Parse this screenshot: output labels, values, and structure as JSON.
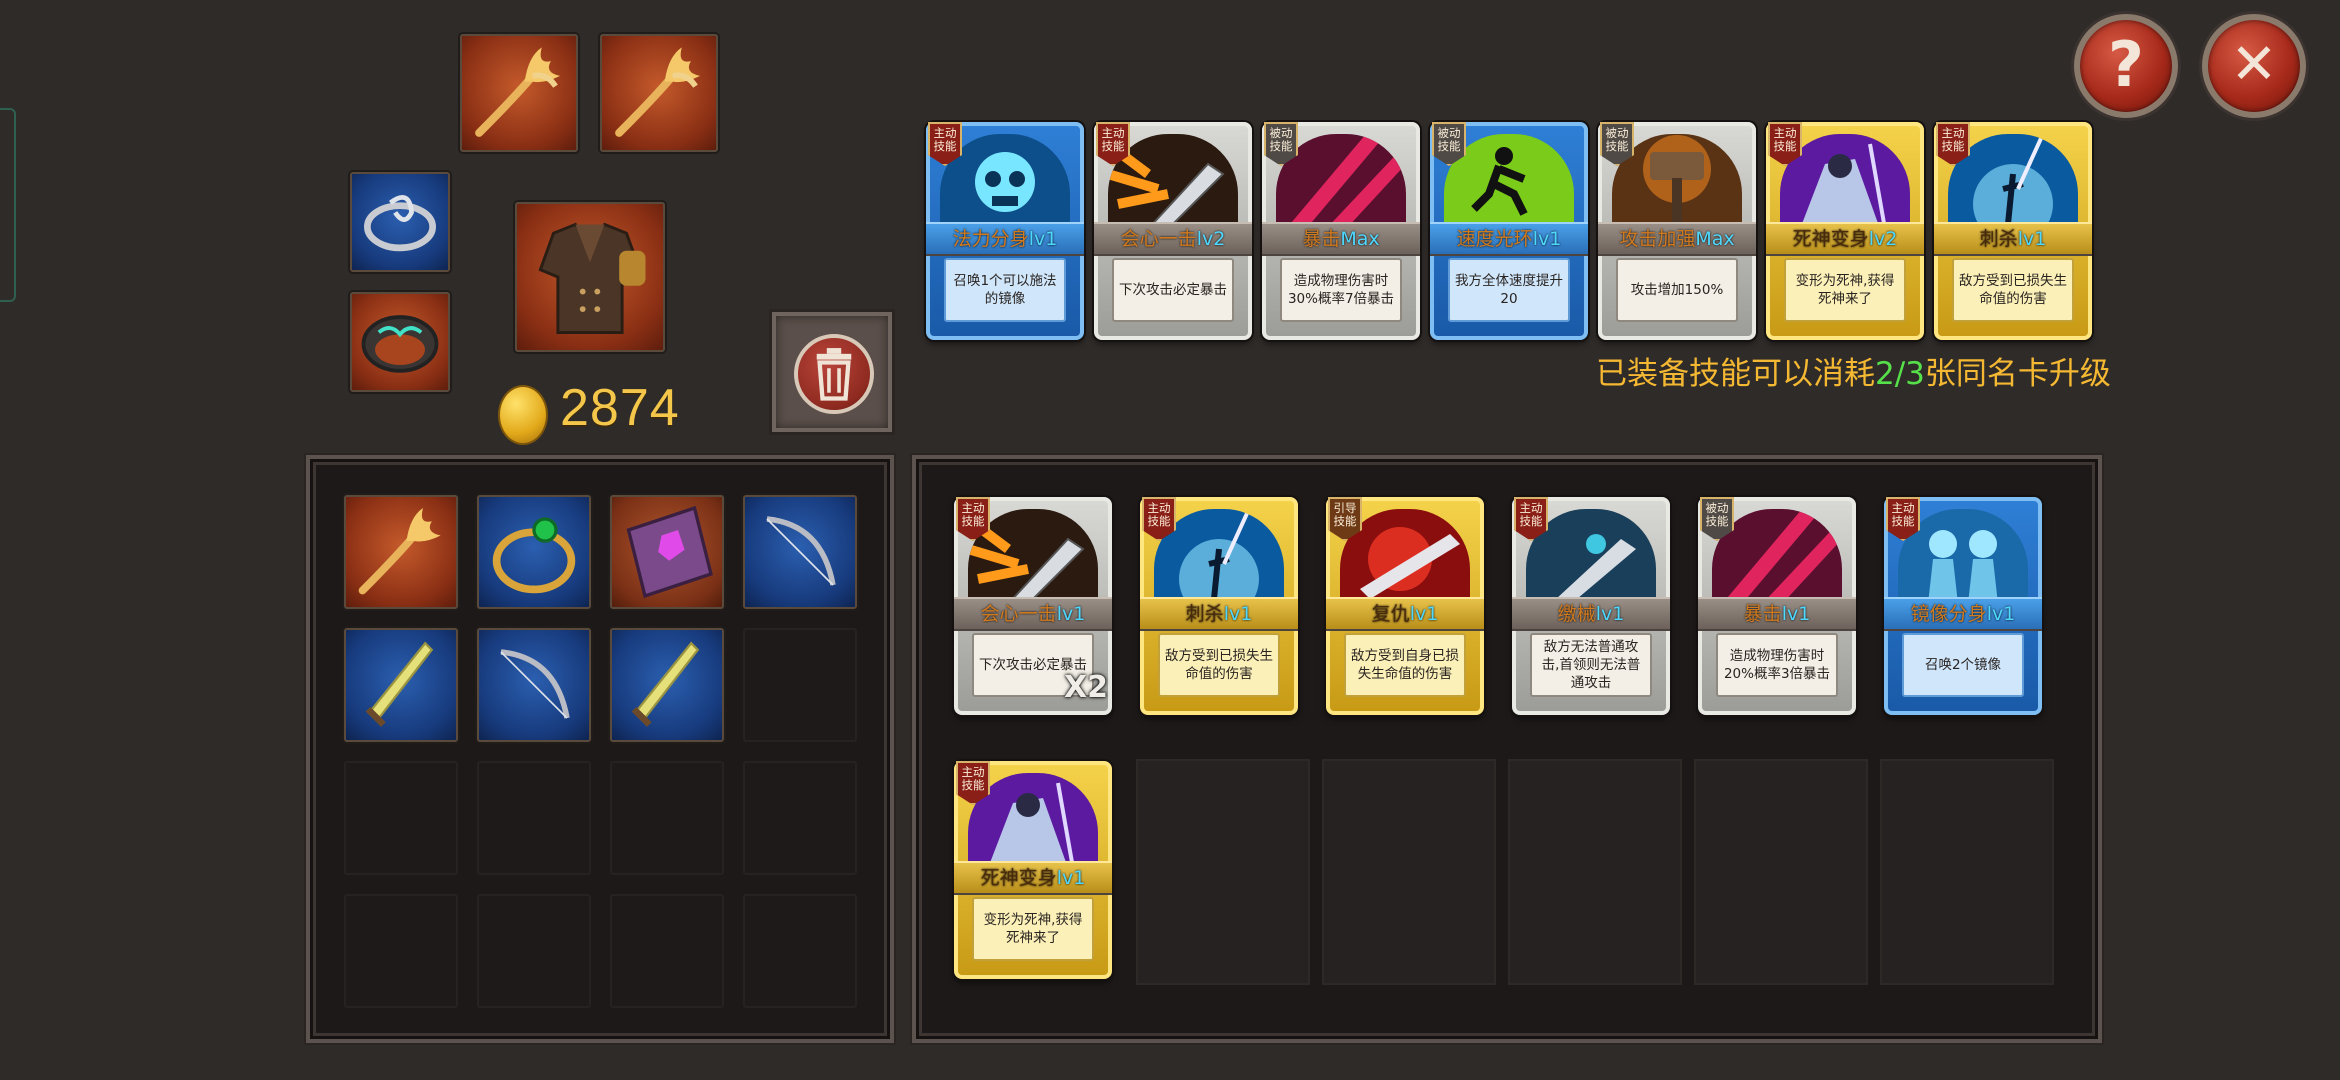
{
  "gold": "2874",
  "upgrade_notice": {
    "prefix": "已装备技能可以消耗",
    "count": "2/3",
    "suffix": "张同名卡升级"
  },
  "buttons": {
    "help": "?",
    "close": "✕"
  },
  "equipped_items": [
    {
      "id": "weapon-1",
      "icon": "flame-staff-icon"
    },
    {
      "id": "weapon-2",
      "icon": "flame-staff-icon"
    },
    {
      "id": "ring-1",
      "icon": "silver-ring-icon"
    },
    {
      "id": "ring-2",
      "icon": "rune-ring-icon"
    },
    {
      "id": "armor",
      "icon": "leather-armor-icon"
    }
  ],
  "inventory": [
    {
      "icon": "flame-staff-icon",
      "bg": "red"
    },
    {
      "icon": "emerald-ring-icon",
      "bg": "blue"
    },
    {
      "icon": "spell-book-icon",
      "bg": "brown"
    },
    {
      "icon": "bow-icon",
      "bg": "blue"
    },
    {
      "icon": "sword-icon",
      "bg": "blue"
    },
    {
      "icon": "bow-icon",
      "bg": "blue"
    },
    {
      "icon": "sword-icon",
      "bg": "blue"
    }
  ],
  "equipped_skills": [
    {
      "badge": "主动技能",
      "type": "active",
      "frame": "blue",
      "name": "法力分身",
      "level": "lv1",
      "desc": "召唤1个可以施法的镜像",
      "art": "skull"
    },
    {
      "badge": "主动技能",
      "type": "active",
      "frame": "silver",
      "name": "会心一击",
      "level": "lv2",
      "desc": "下次攻击必定暴击",
      "art": "blade"
    },
    {
      "badge": "被动技能",
      "type": "passive",
      "frame": "silver",
      "name": "暴击",
      "level": "Max",
      "desc": "造成物理伤害时30%概率7倍暴击",
      "art": "slash"
    },
    {
      "badge": "被动技能",
      "type": "passive",
      "frame": "blue",
      "name": "速度光环",
      "level": "lv1",
      "desc": "我方全体速度提升20",
      "art": "runner"
    },
    {
      "badge": "被动技能",
      "type": "passive",
      "frame": "silver",
      "name": "攻击加强",
      "level": "Max",
      "desc": "攻击增加150%",
      "art": "hammer"
    },
    {
      "badge": "主动技能",
      "type": "active",
      "frame": "gold",
      "name": "死神变身",
      "level": "lv2",
      "desc": "变形为死神,获得死神来了",
      "art": "reaper"
    },
    {
      "badge": "主动技能",
      "type": "active",
      "frame": "gold",
      "name": "刺杀",
      "level": "lv1",
      "desc": "敌方受到已损失生命值的伤害",
      "art": "assassin"
    }
  ],
  "skill_inventory": [
    {
      "badge": "主动技能",
      "type": "active",
      "frame": "silver",
      "name": "会心一击",
      "level": "lv1",
      "desc": "下次攻击必定暴击",
      "art": "blade",
      "count": "X2"
    },
    {
      "badge": "主动技能",
      "type": "active",
      "frame": "gold",
      "name": "刺杀",
      "level": "lv1",
      "desc": "敌方受到已损失生命值的伤害",
      "art": "assassin",
      "count": ""
    },
    {
      "badge": "引导技能",
      "type": "guide",
      "frame": "gold",
      "name": "复仇",
      "level": "lv1",
      "desc": "敌方受到自身已损失生命值的伤害",
      "art": "revenge",
      "count": ""
    },
    {
      "badge": "主动技能",
      "type": "active",
      "frame": "silver",
      "name": "缴械",
      "level": "lv1",
      "desc": "敌方无法普通攻击,首领则无法普通攻击",
      "art": "disarm",
      "count": ""
    },
    {
      "badge": "被动技能",
      "type": "passive",
      "frame": "silver",
      "name": "暴击",
      "level": "lv1",
      "desc": "造成物理伤害时20%概率3倍暴击",
      "art": "slash",
      "count": ""
    },
    {
      "badge": "主动技能",
      "type": "active",
      "frame": "blue",
      "name": "镜像分身",
      "level": "lv1",
      "desc": "召唤2个镜像",
      "art": "mirror",
      "count": ""
    },
    {
      "badge": "主动技能",
      "type": "active",
      "frame": "gold",
      "name": "死神变身",
      "level": "lv1",
      "desc": "变形为死神,获得死神来了",
      "art": "reaper",
      "count": ""
    }
  ]
}
